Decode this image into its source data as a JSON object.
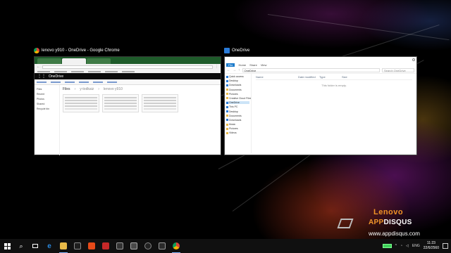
{
  "chrome_window": {
    "caption": "lenovo y910 - OneDrive - Google Chrome",
    "onedrive": {
      "app_name": "OneDrive",
      "nav": [
        "Files",
        "Recent",
        "Photos",
        "Shared",
        "Recycle bin"
      ],
      "breadcrumb": [
        "Files",
        "y-todkaiz",
        "lenovo y910"
      ]
    }
  },
  "explorer_window": {
    "caption": "OneDrive",
    "ribbon": [
      "File",
      "Home",
      "Share",
      "View"
    ],
    "address": "OneDrive",
    "search_placeholder": "Search OneDrive",
    "nav": [
      "Quick access",
      "Desktop",
      "Downloads",
      "Documents",
      "Pictures",
      "Creative Cloud Files",
      "OneDrive",
      "This PC",
      "Desktop",
      "Documents",
      "Downloads",
      "Music",
      "Pictures",
      "Videos"
    ],
    "columns": [
      "Name",
      "Date modified",
      "Type",
      "Size"
    ],
    "empty_message": "This folder is empty."
  },
  "branding": {
    "lenovo": "Lenovo",
    "app_part": "APP",
    "disqus_part": "DISQUS",
    "url": "www.appdisqus.com"
  },
  "taskbar": {
    "language": "ENG",
    "time": "11:23",
    "date": "22/6/2560"
  },
  "colors": {
    "chrome_tab_bar": "#1e5b2a",
    "explorer_file_tab": "#1979ca",
    "brand_orange": "#f0962a",
    "battery_green": "#3fcf5a"
  }
}
